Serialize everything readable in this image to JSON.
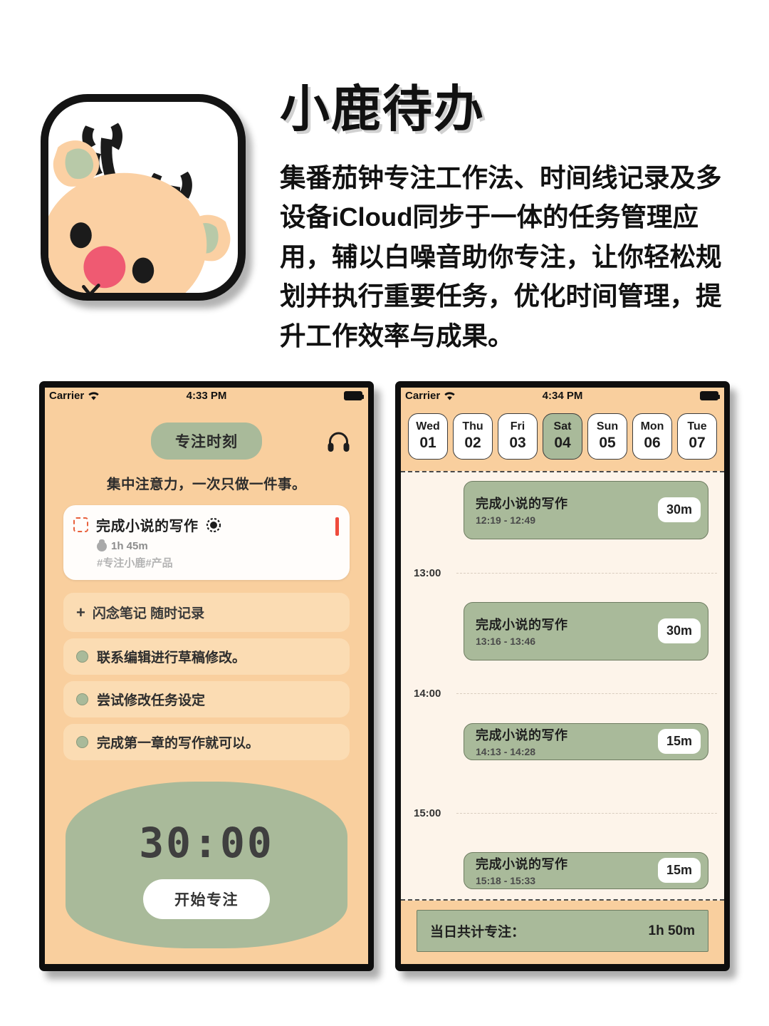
{
  "hero": {
    "title": "小鹿待办",
    "description": "集番茄钟专注工作法、时间线记录及多设备iCloud同步于一体的任务管理应用，辅以白噪音助你专注，让你轻松规划并执行重要任务，优化时间管理，提升工作效率与成果。",
    "icon_name": "deer-app-icon"
  },
  "colors": {
    "background_peach": "#F9CF9E",
    "accent_green": "#A9BA9A",
    "timeline_cream": "#FDF4EA",
    "card_white": "#FFFDFB",
    "flag_red": "#EF4B3C",
    "checkbox_orange": "#E8613D",
    "note_row_bg": "#FBDCB3",
    "frame_black": "#0E0E0E"
  },
  "left_phone": {
    "status_bar": {
      "carrier": "Carrier",
      "time": "4:33 PM",
      "wifi_icon": "wifi-icon",
      "battery_icon": "battery-icon"
    },
    "focus_pill": "专注时刻",
    "headphone_icon": "headphone-icon",
    "subtitle": "集中注意力，一次只做一件事。",
    "task_card": {
      "checkbox_icon": "dashed-checkbox-icon",
      "title": "完成小说的写作",
      "target_icon": "target-icon",
      "duration": "1h 45m",
      "tomato_icon": "tomato-icon",
      "tags": "#专注小鹿#产品",
      "priority_flag": "priority-flag-icon"
    },
    "note_row": {
      "plus_icon": "+",
      "label": "闪念笔记 随时记录"
    },
    "todos": [
      {
        "label": "联系编辑进行草稿修改。",
        "done": false
      },
      {
        "label": "尝试修改任务设定",
        "done": false
      },
      {
        "label": "完成第一章的写作就可以。",
        "done": false
      }
    ],
    "timer": {
      "digits": "30:00",
      "start_button": "开始专注"
    }
  },
  "right_phone": {
    "status_bar": {
      "carrier": "Carrier",
      "time": "4:34 PM",
      "wifi_icon": "wifi-icon",
      "battery_icon": "battery-icon"
    },
    "days": [
      {
        "name": "Wed",
        "num": "01",
        "active": false
      },
      {
        "name": "Thu",
        "num": "02",
        "active": false
      },
      {
        "name": "Fri",
        "num": "03",
        "active": false
      },
      {
        "name": "Sat",
        "num": "04",
        "active": true
      },
      {
        "name": "Sun",
        "num": "05",
        "active": false
      },
      {
        "name": "Mon",
        "num": "06",
        "active": false
      },
      {
        "name": "Tue",
        "num": "07",
        "active": false
      }
    ],
    "hour_labels": [
      "13:00",
      "14:00",
      "15:00"
    ],
    "events": [
      {
        "title": "完成小说的写作",
        "time": "12:19 - 12:49",
        "duration": "30m"
      },
      {
        "title": "完成小说的写作",
        "time": "13:16 - 13:46",
        "duration": "30m"
      },
      {
        "title": "完成小说的写作",
        "time": "14:13 - 14:28",
        "duration": "15m"
      },
      {
        "title": "完成小说的写作",
        "time": "15:18 - 15:33",
        "duration": "15m"
      }
    ],
    "total": {
      "label": "当日共计专注：",
      "value": "1h 50m"
    }
  }
}
